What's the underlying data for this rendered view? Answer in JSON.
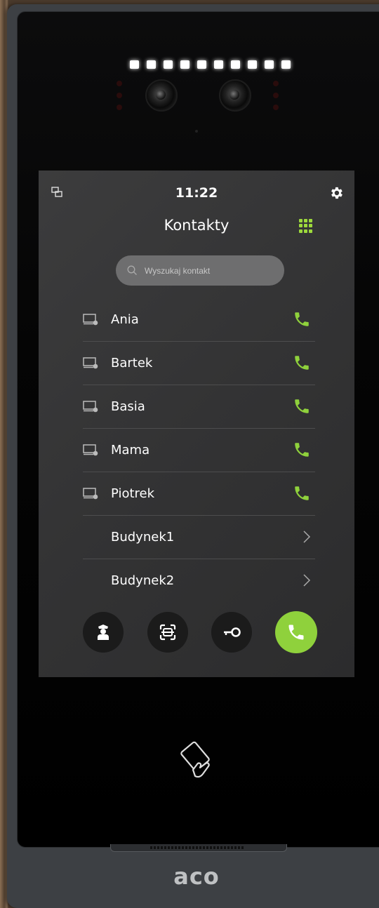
{
  "status": {
    "time": "11:22",
    "network_icon": "network-icon",
    "settings_icon": "gear-icon"
  },
  "header": {
    "title": "Kontakty",
    "dialpad_icon": "dialpad-icon"
  },
  "search": {
    "placeholder": "Wyszukaj kontakt"
  },
  "contacts": [
    {
      "name": "Ania",
      "icon": "monitor-icon",
      "action": "call-icon"
    },
    {
      "name": "Bartek",
      "icon": "monitor-icon",
      "action": "call-icon"
    },
    {
      "name": "Basia",
      "icon": "monitor-icon",
      "action": "call-icon"
    },
    {
      "name": "Mama",
      "icon": "monitor-icon",
      "action": "call-icon"
    },
    {
      "name": "Piotrek",
      "icon": "monitor-icon",
      "action": "call-icon"
    }
  ],
  "groups": [
    {
      "name": "Budynek1",
      "action": "chevron-right-icon"
    },
    {
      "name": "Budynek2",
      "action": "chevron-right-icon"
    }
  ],
  "actions": [
    "concierge-icon",
    "qr-scan-icon",
    "key-icon",
    "call-icon"
  ],
  "brand": {
    "logo": "aco"
  },
  "colors": {
    "accent": "#8fd13c",
    "screen_bg": "#363637",
    "search_bg": "#6e6e6f"
  }
}
